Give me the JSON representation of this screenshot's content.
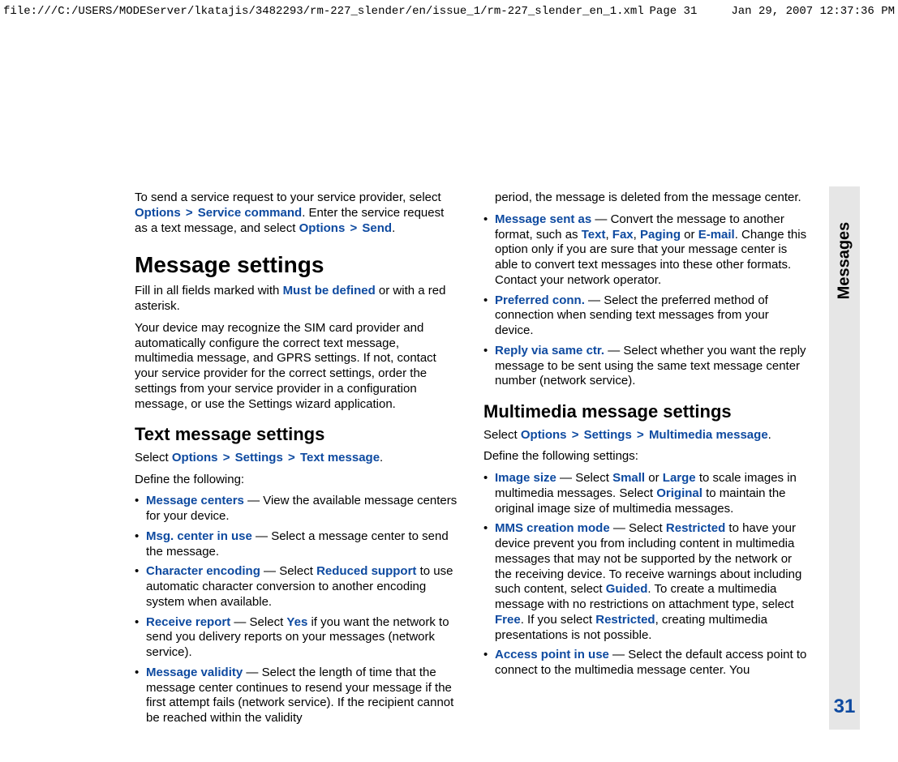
{
  "header": {
    "path": "file:///C:/USERS/MODEServer/lkatajis/3482293/rm-227_slender/en/issue_1/rm-227_slender_en_1.xml",
    "page": "Page 31",
    "timestamp": "Jan 29, 2007 12:37:36 PM"
  },
  "tab": {
    "label": "Messages",
    "page_number": "31"
  },
  "left": {
    "intro1a": "To send a service request to your service provider, select ",
    "options": "Options",
    "gt": ">",
    "service_command": "Service command",
    "intro1b": ". Enter the service request as a text message, and select ",
    "send": "Send",
    "dot": ".",
    "h1": "Message settings",
    "p2a": "Fill in all fields marked with ",
    "must_be_defined": "Must be defined",
    "p2b": " or with a red asterisk.",
    "p3": "Your device may recognize the SIM card provider and automatically configure the correct text message, multimedia message, and GPRS settings. If not, contact your service provider for the correct settings, order the settings from your service provider in a configuration message, or use the Settings wizard application.",
    "h2": "Text message settings",
    "sel_a": "Select ",
    "settings": "Settings",
    "text_message": "Text message",
    "define": "Define the following:",
    "li1": {
      "k": "Message centers",
      "v": " — View the available message centers for your device."
    },
    "li2": {
      "k": "Msg. center in use",
      "v": " — Select a message center to send the message."
    },
    "li3": {
      "k": "Character encoding",
      "a": " — Select ",
      "r": "Reduced support",
      "b": " to use automatic character conversion to another encoding system when available."
    },
    "li4": {
      "k": "Receive report",
      "a": " — Select ",
      "r": "Yes",
      "b": " if you want the network to send you delivery reports on your messages (network service)."
    },
    "li5": {
      "k": "Message validity",
      "v": " — Select the length of time that the message center continues to resend your message if the first attempt fails (network service). If the recipient cannot be reached within the validity"
    }
  },
  "right": {
    "cont": "period, the message is deleted from the message center.",
    "li_msa": {
      "k": "Message sent as",
      "a": " — Convert the message to another format, such as ",
      "t1": "Text",
      "c": ", ",
      "t2": "Fax",
      "t3": "Paging",
      "or": " or ",
      "t4": "E-mail",
      "b": ". Change this option only if you are sure that your message center is able to convert text messages into these other formats. Contact your network operator."
    },
    "li_pc": {
      "k": "Preferred conn.",
      "v": " — Select the preferred method of connection when sending text messages from your device."
    },
    "li_rv": {
      "k": "Reply via same ctr.",
      "v": " — Select whether you want the reply message to be sent using the same text message center number (network service)."
    },
    "h2": "Multimedia message settings",
    "sel_a": "Select ",
    "options": "Options",
    "gt": ">",
    "settings": "Settings",
    "mm": "Multimedia message",
    "dot": ".",
    "define": "Define the following settings:",
    "li_is": {
      "k": "Image size",
      "a": " — Select ",
      "s": "Small",
      "or": " or ",
      "l": "Large",
      "b": " to scale images in multimedia messages. Select ",
      "o": "Original",
      "c": " to maintain the original image size of multimedia messages."
    },
    "li_cm": {
      "k": "MMS creation mode",
      "a": " — Select ",
      "r": "Restricted",
      "b": " to have your device prevent you from including content in multimedia messages that may not be supported by the network or the receiving device. To receive warnings about including such content, select ",
      "g": "Guided",
      "c": ". To create a multimedia message with no restrictions on attachment type, select ",
      "f": "Free",
      "d": ". If you select ",
      "r2": "Restricted",
      "e": ", creating multimedia presentations is not possible."
    },
    "li_ap": {
      "k": "Access point in use",
      "v": " — Select the default access point to connect to the multimedia message center. You"
    }
  }
}
